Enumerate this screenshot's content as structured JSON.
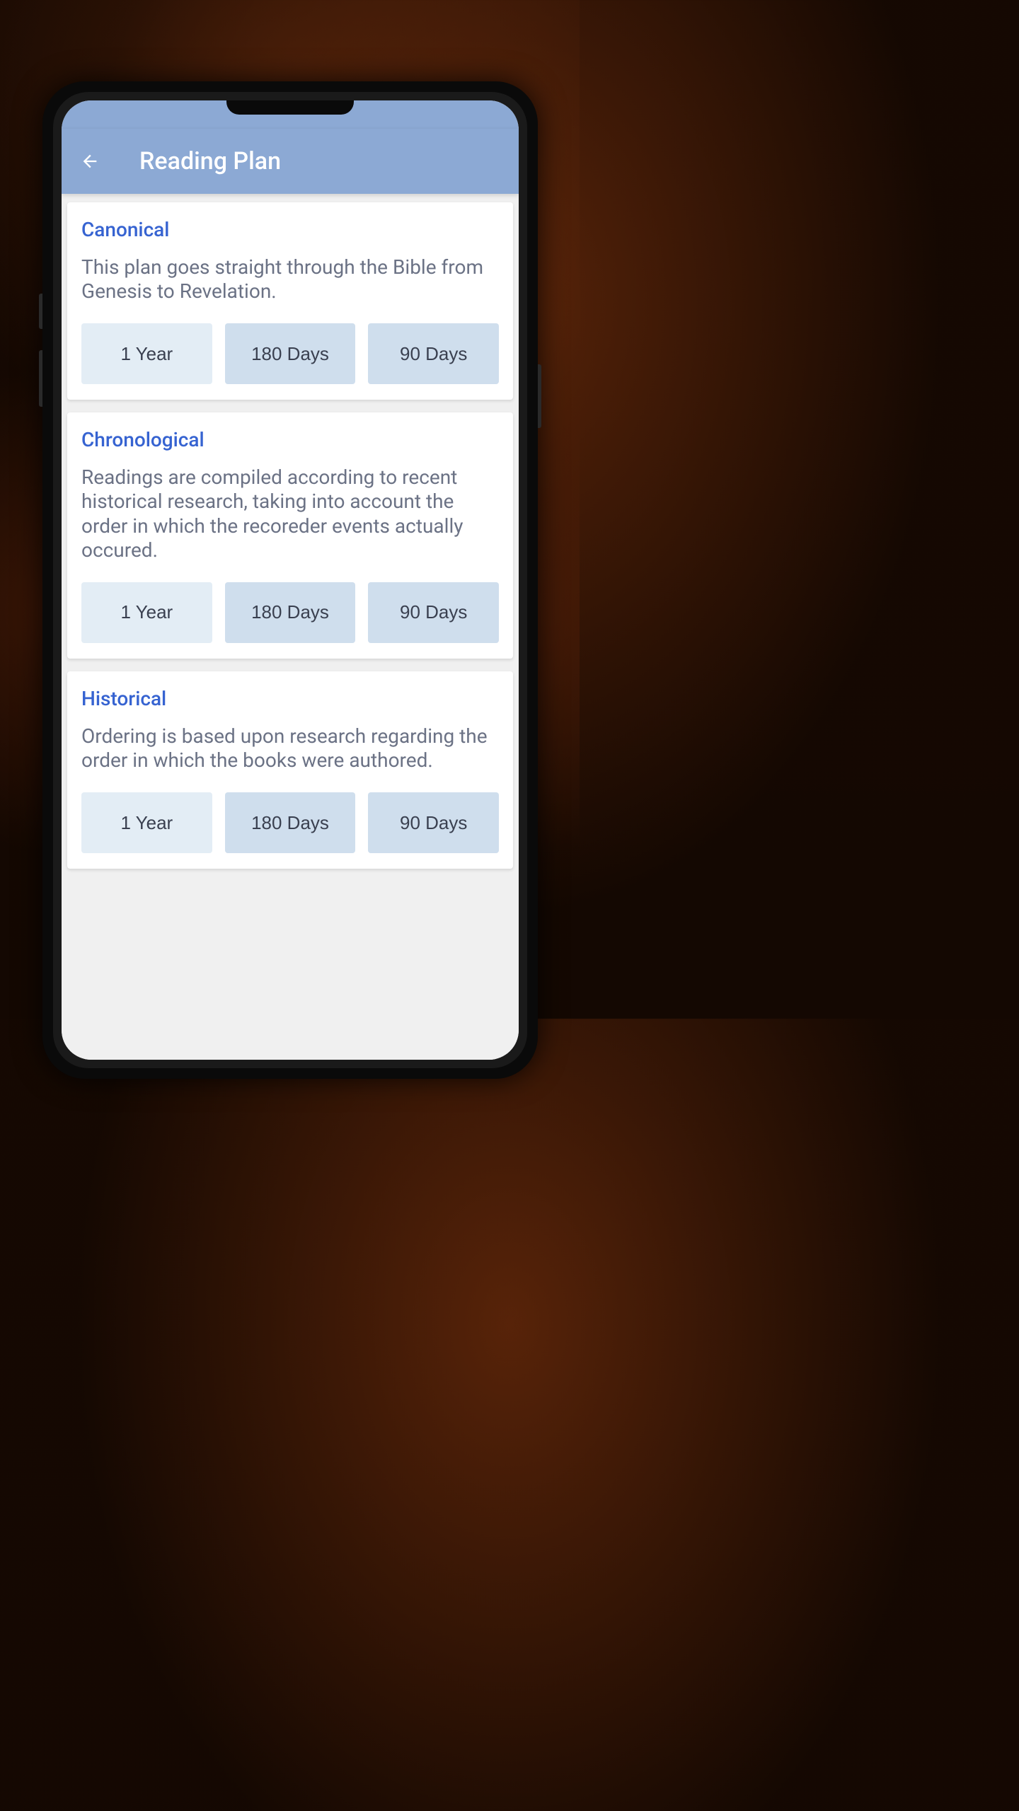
{
  "header": {
    "title": "Reading Plan"
  },
  "plans": [
    {
      "title": "Canonical",
      "description": "This plan goes straight through the Bible from Genesis to Revelation.",
      "durations": [
        "1 Year",
        "180 Days",
        "90 Days"
      ]
    },
    {
      "title": "Chronological",
      "description": "Readings are compiled according to recent historical research, taking into account the order in which the recoreder events actually occured.",
      "durations": [
        "1 Year",
        "180 Days",
        "90 Days"
      ]
    },
    {
      "title": "Historical",
      "description": "Ordering is based upon research regarding the order in which the books were authored.",
      "durations": [
        "1 Year",
        "180 Days",
        "90 Days"
      ]
    }
  ]
}
